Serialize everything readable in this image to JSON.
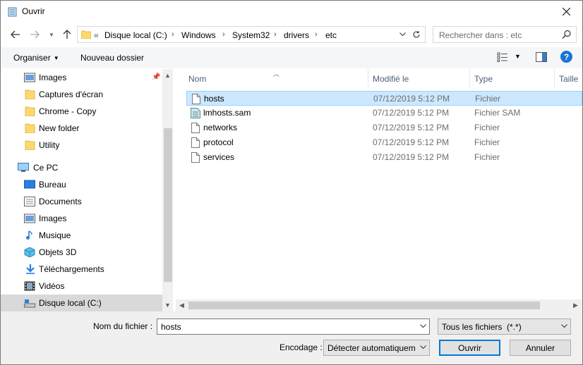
{
  "window": {
    "title": "Ouvrir"
  },
  "address": {
    "prefix": "«",
    "crumbs": [
      "Disque local (C:)",
      "Windows",
      "System32",
      "drivers",
      "etc"
    ]
  },
  "search": {
    "placeholder": "Rechercher dans : etc"
  },
  "toolbar": {
    "organize_label": "Organiser",
    "new_folder_label": "Nouveau dossier"
  },
  "nav": {
    "quick_items": [
      {
        "label": "Images",
        "icon": "pictures-icon"
      },
      {
        "label": "Captures d'écran",
        "icon": "folder-icon"
      },
      {
        "label": "Chrome - Copy",
        "icon": "folder-icon"
      },
      {
        "label": "New folder",
        "icon": "folder-icon"
      },
      {
        "label": "Utility",
        "icon": "folder-icon"
      }
    ],
    "this_pc": "Ce PC",
    "pc_items": [
      {
        "label": "Bureau",
        "icon": "desktop-icon"
      },
      {
        "label": "Documents",
        "icon": "documents-icon"
      },
      {
        "label": "Images",
        "icon": "pictures-icon"
      },
      {
        "label": "Musique",
        "icon": "music-icon"
      },
      {
        "label": "Objets 3D",
        "icon": "objects-3d-icon"
      },
      {
        "label": "Téléchargements",
        "icon": "downloads-icon"
      },
      {
        "label": "Vidéos",
        "icon": "videos-icon"
      },
      {
        "label": "Disque local (C:)",
        "icon": "drive-icon"
      }
    ]
  },
  "columns": {
    "name": "Nom",
    "modified": "Modifié le",
    "type": "Type",
    "size": "Taille"
  },
  "files": [
    {
      "name": "hosts",
      "date": "07/12/2019 5:12 PM",
      "type": "Fichier",
      "selected": true
    },
    {
      "name": "lmhosts.sam",
      "date": "07/12/2019 5:12 PM",
      "type": "Fichier SAM",
      "selected": false
    },
    {
      "name": "networks",
      "date": "07/12/2019 5:12 PM",
      "type": "Fichier",
      "selected": false
    },
    {
      "name": "protocol",
      "date": "07/12/2019 5:12 PM",
      "type": "Fichier",
      "selected": false
    },
    {
      "name": "services",
      "date": "07/12/2019 5:12 PM",
      "type": "Fichier",
      "selected": false
    }
  ],
  "bottom": {
    "filename_label": "Nom du fichier :",
    "filename_value": "hosts",
    "filter_value": "Tous les fichiers  (*.*)",
    "encoding_label": "Encodage :",
    "encoding_value": "Détecter automatiquem",
    "open_label": "Ouvrir",
    "cancel_label": "Annuler"
  },
  "colors": {
    "accent": "#0078d7",
    "selection": "#cce8ff",
    "folder": "#ffd86b",
    "help": "#1a72d6"
  }
}
